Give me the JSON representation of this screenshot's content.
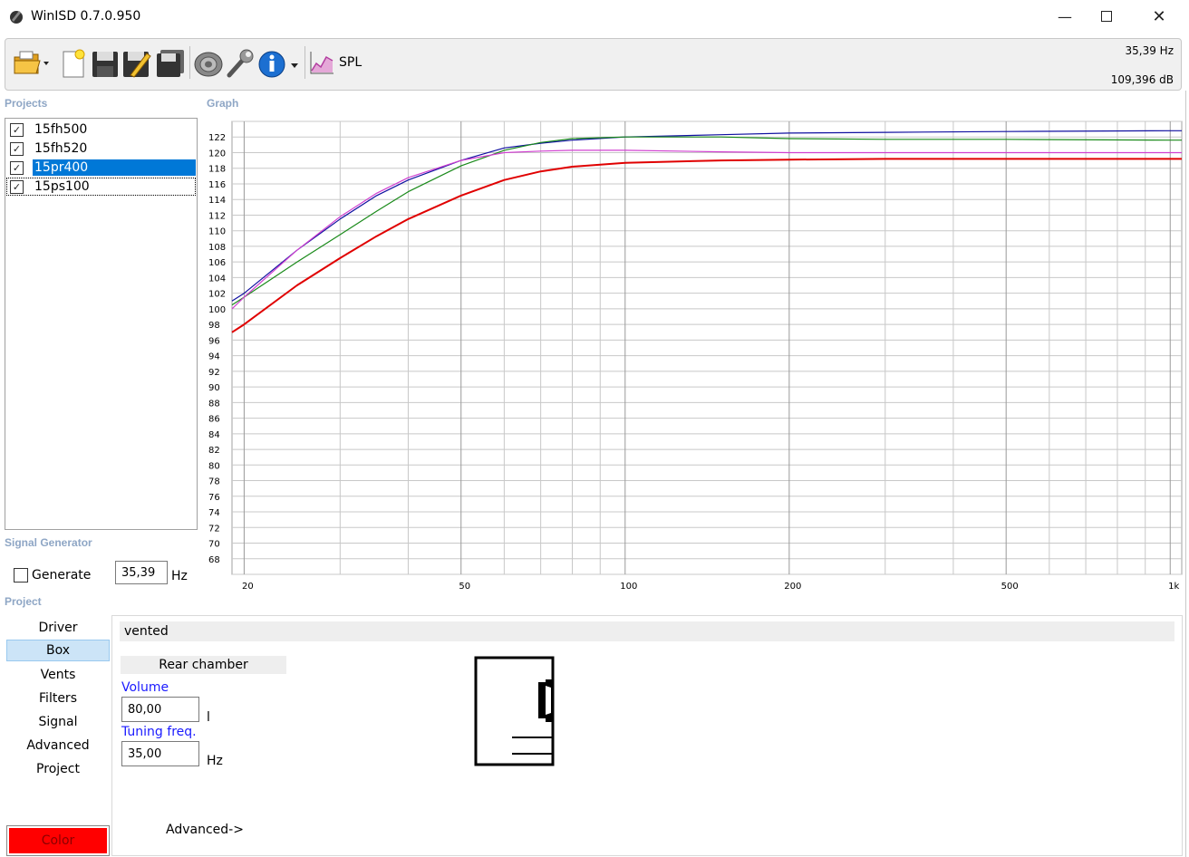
{
  "window": {
    "title": "WinISD 0.7.0.950"
  },
  "toolbar": {
    "spl_label": "SPL",
    "readout_freq": "35,39 Hz",
    "readout_level": "109,396 dB"
  },
  "sections": {
    "projects": "Projects",
    "graph": "Graph",
    "signal_generator": "Signal Generator",
    "project": "Project"
  },
  "projects": [
    {
      "name": "15fh500",
      "checked": true,
      "selected": false
    },
    {
      "name": "15fh520",
      "checked": true,
      "selected": false
    },
    {
      "name": "15pr400",
      "checked": true,
      "selected": true
    },
    {
      "name": "15ps100",
      "checked": true,
      "selected": false
    }
  ],
  "signal_generator": {
    "generate_label": "Generate",
    "frequency": "35,39",
    "unit": "Hz"
  },
  "nav": {
    "items": [
      "Driver",
      "Box",
      "Vents",
      "Filters",
      "Signal",
      "Advanced",
      "Project"
    ],
    "active": "Box",
    "color_button": "Color"
  },
  "box": {
    "type": "vented",
    "chamber_title": "Rear chamber",
    "volume_label": "Volume",
    "volume_value": "80,00",
    "volume_unit": "l",
    "tuning_label": "Tuning freq.",
    "tuning_value": "35,00",
    "tuning_unit": "Hz",
    "advanced_link": "Advanced->"
  },
  "colors": {
    "selection": "#0078d7",
    "series_red": "#e00000",
    "series_blue": "#1010a0",
    "series_green": "#1a8a1a",
    "series_magenta": "#d040d0"
  },
  "chart_data": {
    "type": "line",
    "xscale": "log",
    "xlim": [
      19,
      1050
    ],
    "ylim": [
      66,
      124
    ],
    "x_ticks": [
      20,
      50,
      100,
      200,
      500,
      1000
    ],
    "x_tick_labels": [
      "20",
      "50",
      "100",
      "200",
      "500",
      "1k"
    ],
    "y_ticks": [
      68,
      70,
      72,
      74,
      76,
      78,
      80,
      82,
      84,
      86,
      88,
      90,
      92,
      94,
      96,
      98,
      100,
      102,
      104,
      106,
      108,
      110,
      112,
      114,
      116,
      118,
      120,
      122
    ],
    "grid": true,
    "series": [
      {
        "color": "#e00000",
        "x": [
          19,
          20,
          25,
          30,
          35,
          40,
          50,
          60,
          70,
          80,
          100,
          150,
          200,
          300,
          500,
          1000,
          1050
        ],
        "y": [
          97.0,
          98.0,
          103.0,
          106.5,
          109.3,
          111.5,
          114.5,
          116.5,
          117.6,
          118.2,
          118.7,
          119.0,
          119.1,
          119.2,
          119.2,
          119.2,
          119.2
        ]
      },
      {
        "color": "#1010a0",
        "x": [
          19,
          20,
          25,
          30,
          35,
          40,
          50,
          60,
          70,
          80,
          100,
          150,
          200,
          300,
          500,
          1000,
          1050
        ],
        "y": [
          101.0,
          102.0,
          107.5,
          111.5,
          114.5,
          116.5,
          119.0,
          120.6,
          121.2,
          121.6,
          122.0,
          122.3,
          122.5,
          122.6,
          122.7,
          122.8,
          122.8
        ]
      },
      {
        "color": "#1a8a1a",
        "x": [
          19,
          20,
          25,
          30,
          35,
          40,
          50,
          60,
          70,
          80,
          100,
          150,
          200,
          300,
          500,
          1000,
          1050
        ],
        "y": [
          100.5,
          101.5,
          106.0,
          109.5,
          112.5,
          115.0,
          118.3,
          120.3,
          121.3,
          121.8,
          122.0,
          122.0,
          121.8,
          121.7,
          121.7,
          121.6,
          121.6
        ]
      },
      {
        "color": "#d040d0",
        "x": [
          19,
          20,
          25,
          30,
          35,
          40,
          50,
          60,
          70,
          80,
          100,
          150,
          200,
          300,
          500,
          1000,
          1050
        ],
        "y": [
          100.0,
          101.5,
          107.5,
          111.8,
          114.8,
          116.8,
          119.0,
          120.0,
          120.2,
          120.3,
          120.3,
          120.1,
          120.0,
          120.0,
          120.0,
          120.0,
          120.0
        ]
      }
    ]
  }
}
